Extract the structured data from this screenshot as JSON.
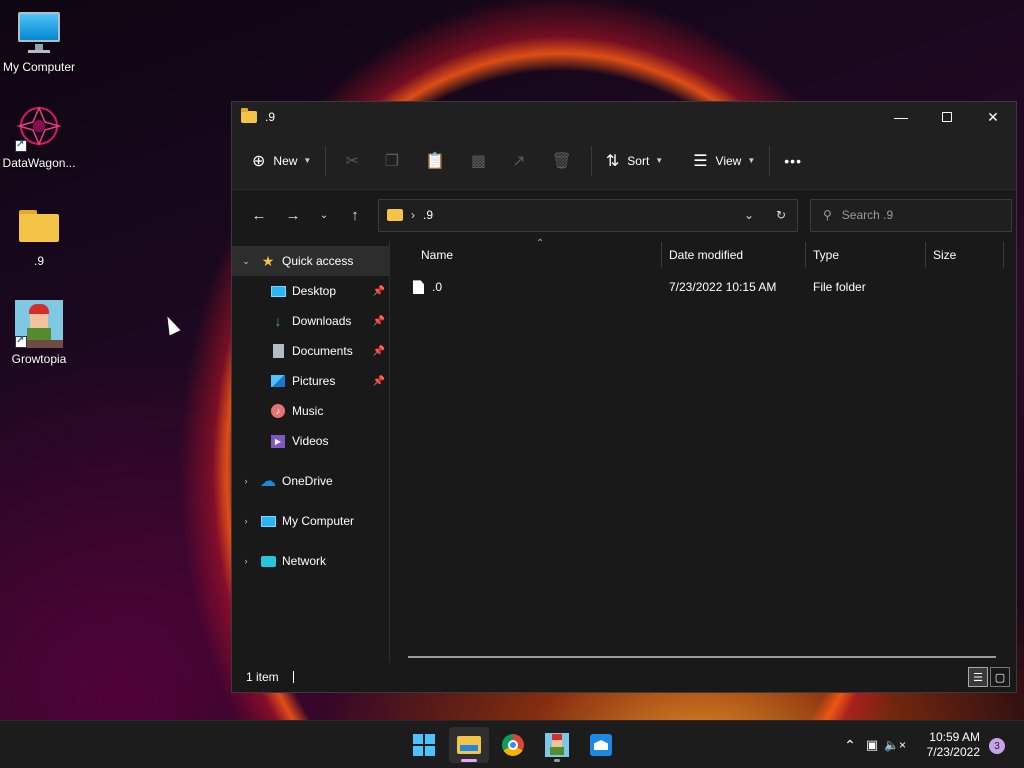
{
  "desktop": {
    "icons": [
      {
        "label": "My Computer"
      },
      {
        "label": "DataWagon..."
      },
      {
        "label": ".9"
      },
      {
        "label": "Growtopia"
      }
    ]
  },
  "window": {
    "title": ".9",
    "commandbar": {
      "new_label": "New",
      "sort_label": "Sort",
      "view_label": "View",
      "more_label": "•••"
    },
    "address": {
      "crumb": ".9",
      "search_placeholder": "Search .9"
    },
    "sidebar": {
      "quick_access": "Quick access",
      "items": [
        {
          "label": "Desktop"
        },
        {
          "label": "Downloads"
        },
        {
          "label": "Documents"
        },
        {
          "label": "Pictures"
        },
        {
          "label": "Music"
        },
        {
          "label": "Videos"
        }
      ],
      "roots": [
        {
          "label": "OneDrive"
        },
        {
          "label": "My Computer"
        },
        {
          "label": "Network"
        }
      ]
    },
    "columns": [
      "Name",
      "Date modified",
      "Type",
      "Size"
    ],
    "rows": [
      {
        "name": ".0",
        "date": "7/23/2022 10:15 AM",
        "type": "File folder",
        "size": ""
      }
    ],
    "status": "1 item"
  },
  "taskbar": {
    "time": "10:59 AM",
    "date": "7/23/2022",
    "notification_count": "3"
  },
  "colors": {
    "accent": "#e8a3ff",
    "folder": "#f3c446"
  }
}
